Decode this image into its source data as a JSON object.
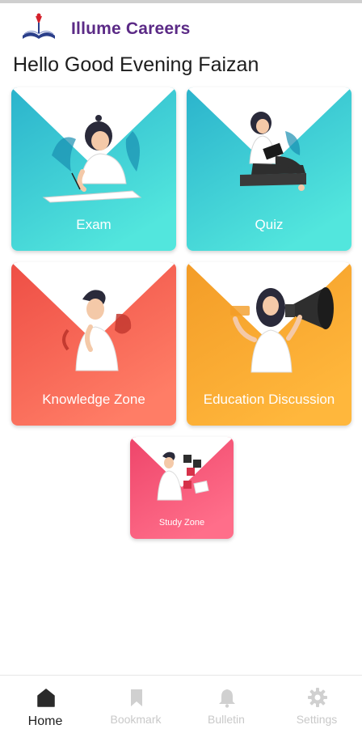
{
  "app": {
    "title": "Illume Careers"
  },
  "greeting": "Hello Good Evening Faizan",
  "cards": {
    "exam": {
      "label": "Exam",
      "color_top": "#2fb9cf",
      "color_bottom": "#4fe3dc"
    },
    "quiz": {
      "label": "Quiz",
      "color_top": "#2fb9cf",
      "color_bottom": "#4fe3dc"
    },
    "knowledge": {
      "label": "Knowledge Zone",
      "color_top": "#f0554a",
      "color_bottom": "#ff7a63"
    },
    "education": {
      "label": "Education Discussion",
      "color_top": "#f5a22c",
      "color_bottom": "#ffb63a"
    },
    "study": {
      "label": "Study Zone",
      "color_top": "#f0476a",
      "color_bottom": "#ff6d8a"
    }
  },
  "nav": {
    "items": [
      {
        "label": "Home",
        "icon": "home-icon",
        "active": true
      },
      {
        "label": "Bookmark",
        "icon": "bookmark-icon",
        "active": false
      },
      {
        "label": "Bulletin",
        "icon": "bell-icon",
        "active": false
      },
      {
        "label": "Settings",
        "icon": "gear-icon",
        "active": false
      }
    ]
  }
}
